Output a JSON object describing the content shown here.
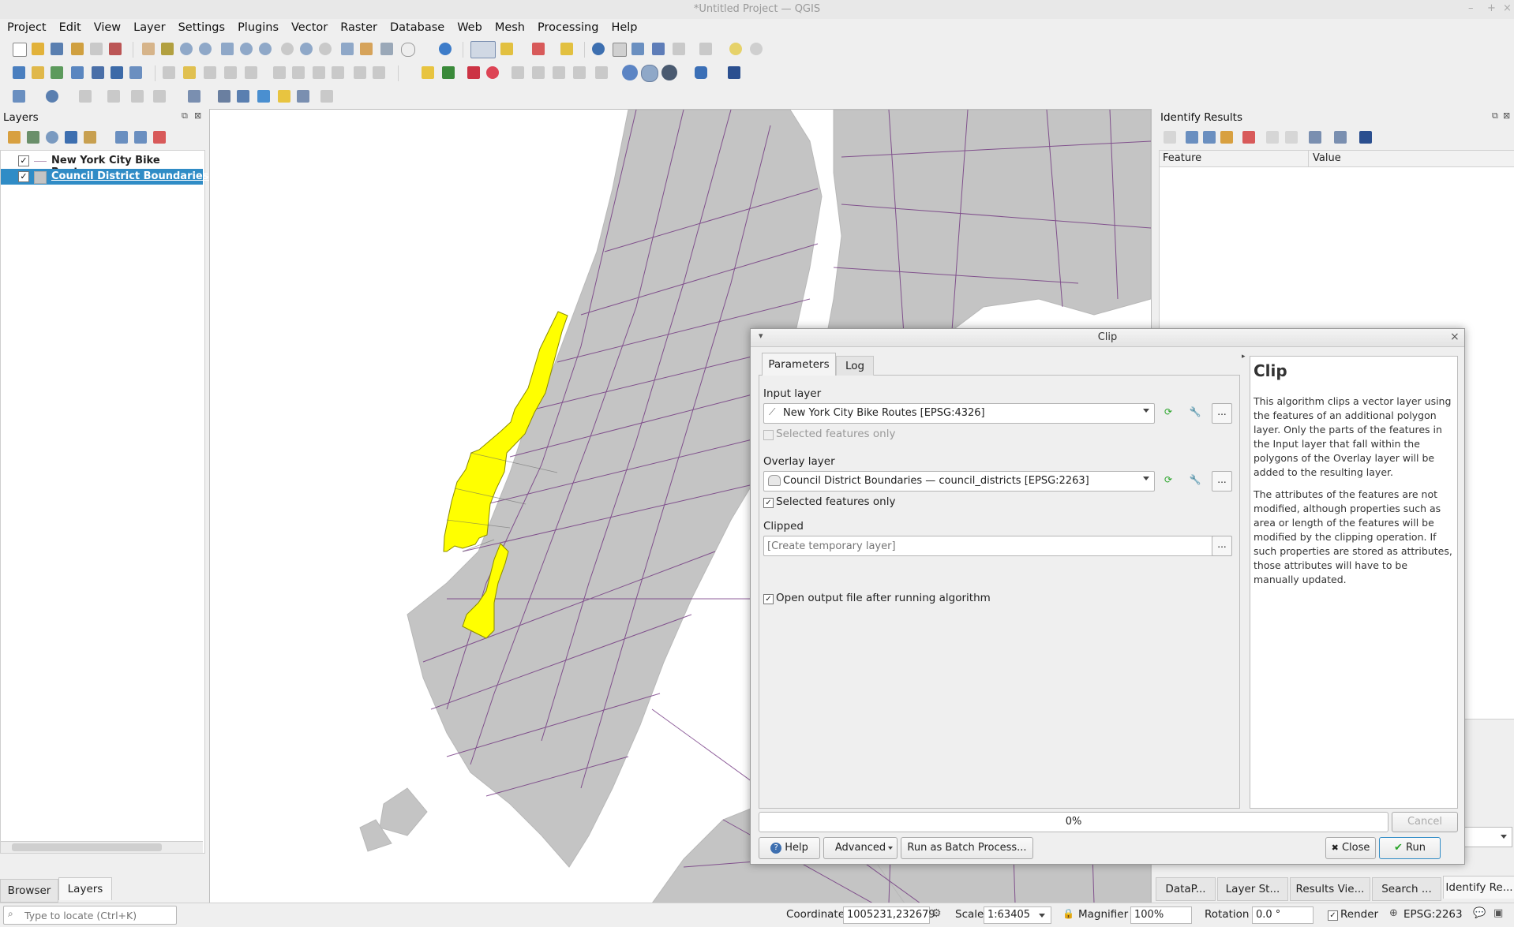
{
  "window": {
    "title": "*Untitled Project — QGIS",
    "controls": [
      "–",
      "+",
      "×"
    ]
  },
  "menu": [
    "Project",
    "Edit",
    "View",
    "Layer",
    "Settings",
    "Plugins",
    "Vector",
    "Raster",
    "Database",
    "Web",
    "Mesh",
    "Processing",
    "Help"
  ],
  "layers_panel": {
    "title": "Layers",
    "layers": [
      {
        "name": "New York City Bike Routes",
        "checked": true,
        "selected": false
      },
      {
        "name": "Council District Boundaries —",
        "checked": true,
        "selected": true
      }
    ],
    "tabs": [
      "Browser",
      "Layers"
    ],
    "active_tab": "Layers"
  },
  "identify": {
    "title": "Identify Results",
    "columns": [
      "Feature",
      "Value"
    ],
    "tabs": [
      "DataP...",
      "Layer St...",
      "Results Vie...",
      "Search ...",
      "Identify Re..."
    ]
  },
  "dialog": {
    "title": "Clip",
    "tabs": [
      "Parameters",
      "Log"
    ],
    "active_tab": "Parameters",
    "input_layer_label": "Input layer",
    "input_layer_value": "New York City Bike Routes [EPSG:4326]",
    "input_selected_only": "Selected features only",
    "input_selected_checked": false,
    "overlay_label": "Overlay layer",
    "overlay_value": "Council District Boundaries — council_districts [EPSG:2263]",
    "overlay_selected_only": "Selected features only",
    "overlay_selected_checked": true,
    "clipped_label": "Clipped",
    "clipped_placeholder": "[Create temporary layer]",
    "open_output": "Open output file after running algorithm",
    "open_output_checked": true,
    "browse": "...",
    "help_title": "Clip",
    "help_p1": "This algorithm clips a vector layer using the features of an additional polygon layer. Only the parts of the features in the Input layer that fall within the polygons of the Overlay layer will be added to the resulting layer.",
    "help_p2": "The attributes of the features are not modified, although properties such as area or length of the features will be modified by the clipping operation. If such properties are stored as attributes, those attributes will have to be manually updated.",
    "progress": "0%",
    "progress_value": 0,
    "cancel": "Cancel",
    "help_btn": "Help",
    "advanced_btn": "Advanced",
    "batch_btn": "Run as Batch Process...",
    "close_btn": "Close",
    "run_btn": "Run"
  },
  "status": {
    "locate_placeholder": "Type to locate (Ctrl+K)",
    "coordinate_label": "Coordinate",
    "coordinate_value": "1005231,232679",
    "scale_label": "Scale",
    "scale_value": "1:63405",
    "magnifier_label": "Magnifier",
    "magnifier_value": "100%",
    "rotation_label": "Rotation",
    "rotation_value": "0.0 °",
    "render_label": "Render",
    "crs": "EPSG:2263"
  },
  "colors": {
    "accent": "#308cc6",
    "selection": "#ffff00",
    "routes": "#6a2a7a",
    "land": "#c4c4c4",
    "run_icon": "#2aa52a"
  }
}
